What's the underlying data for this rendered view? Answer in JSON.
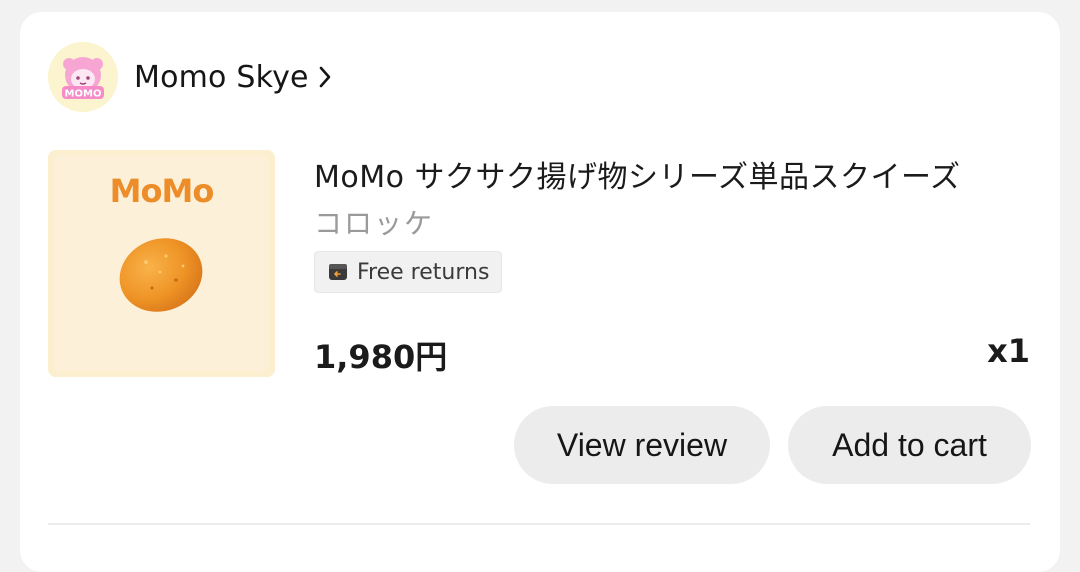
{
  "shop": {
    "name": "Momo Skye",
    "avatar_icon": "momo-character-avatar",
    "avatar_text": "MOMO",
    "chevron_icon": "chevron-right-icon"
  },
  "product": {
    "image_brand": "MoMo",
    "title": "MoMo サクサク揚げ物シリーズ単品スクイーズ",
    "variant": "コロッケ",
    "badge": {
      "icon": "return-box-icon",
      "label": "Free returns"
    },
    "price": "1,980円",
    "quantity": "x1"
  },
  "actions": {
    "view_review": "View review",
    "add_to_cart": "Add to cart"
  },
  "colors": {
    "background": "#f2f2f2",
    "card": "#ffffff",
    "button": "#ececec",
    "thumb_bg": "#fbefcf",
    "brand_orange": "#ec8d2a",
    "avatar_bg": "#fbf4cf",
    "avatar_pink": "#f58cc8"
  }
}
